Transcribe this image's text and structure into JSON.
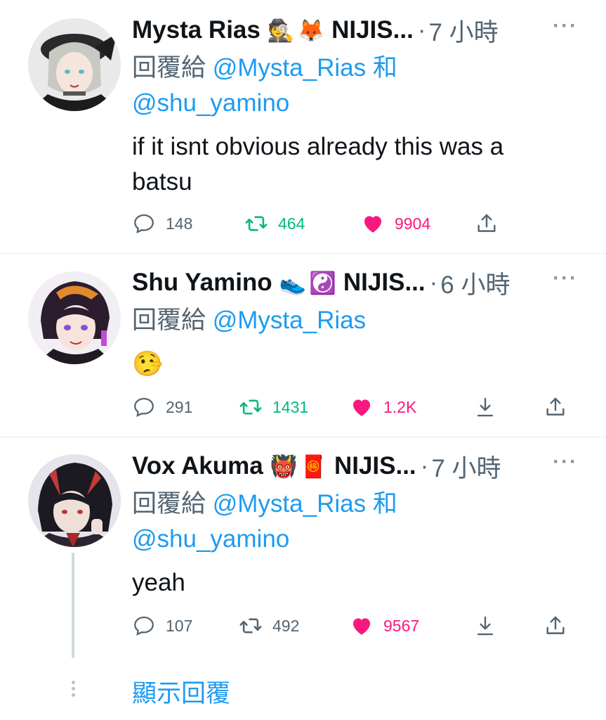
{
  "tweets": [
    {
      "name": "Mysta Rias",
      "emoji1": "🕵️",
      "emoji2": "🦊",
      "org": "NIJIS...",
      "time": "7 小時",
      "reply_prefix": "回覆給",
      "reply_handle1": "@Mysta_Rias",
      "reply_and": "和",
      "reply_handle2": "@shu_yamino",
      "text_line1": "if it isnt obvious already this was a",
      "text_line2": "batsu",
      "replies": "148",
      "retweets": "464",
      "likes": "9904",
      "liked": true,
      "retweet_active": true
    },
    {
      "name": "Shu Yamino",
      "emoji1": "👟",
      "emoji2": "☯️",
      "org": "NIJIS...",
      "time": "6 小時",
      "reply_prefix": "回覆給",
      "reply_handle1": "@Mysta_Rias",
      "text_line1": "🤥",
      "replies": "291",
      "retweets": "1431",
      "likes": "1.2K",
      "liked": true,
      "retweet_active": true
    },
    {
      "name": "Vox Akuma",
      "emoji1": "👹",
      "emoji2": "🧧",
      "org": "NIJIS...",
      "time": "7 小時",
      "reply_prefix": "回覆給",
      "reply_handle1": "@Mysta_Rias",
      "reply_and": "和",
      "reply_handle2": "@shu_yamino",
      "text_line1": "yeah",
      "replies": "107",
      "retweets": "492",
      "likes": "9567",
      "liked": true,
      "retweet_active": false
    }
  ],
  "show_replies_label": "顯示回覆",
  "more_glyph": "···",
  "colors": {
    "accent": "#1d9bf0",
    "like": "#f91880",
    "retweet": "#00ba7c",
    "muted": "#536471"
  },
  "icons": [
    "reply-icon",
    "retweet-icon",
    "heart-icon",
    "share-icon",
    "download-icon",
    "more-icon"
  ]
}
